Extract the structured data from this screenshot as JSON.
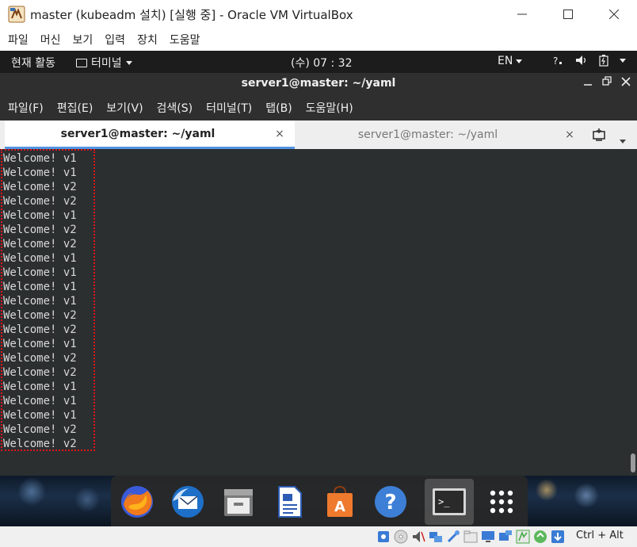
{
  "window": {
    "title": "master (kubeadm 설치) [실행 중] - Oracle VM VirtualBox"
  },
  "vbox_menu": [
    "파일",
    "머신",
    "보기",
    "입력",
    "장치",
    "도움말"
  ],
  "gnome_bar": {
    "activities": "현재 활동",
    "app_menu": "터미널",
    "clock": "(수) 07 : 32",
    "lang": "EN"
  },
  "terminal": {
    "title": "server1@master: ~/yaml",
    "menu": [
      "파일(F)",
      "편집(E)",
      "보기(V)",
      "검색(S)",
      "터미널(T)",
      "탭(B)",
      "도움말(H)"
    ],
    "tabs": [
      {
        "label": "server1@master: ~/yaml",
        "active": true
      },
      {
        "label": "server1@master: ~/yaml",
        "active": false
      }
    ],
    "close_glyph": "×",
    "output": [
      "Welcome! v1",
      "Welcome! v1",
      "Welcome! v2",
      "Welcome! v2",
      "Welcome! v1",
      "Welcome! v2",
      "Welcome! v2",
      "Welcome! v1",
      "Welcome! v1",
      "Welcome! v1",
      "Welcome! v1",
      "Welcome! v2",
      "Welcome! v2",
      "Welcome! v1",
      "Welcome! v2",
      "Welcome! v2",
      "Welcome! v1",
      "Welcome! v1",
      "Welcome! v1",
      "Welcome! v2",
      "Welcome! v2"
    ]
  },
  "dock": {
    "items": [
      {
        "name": "firefox-icon"
      },
      {
        "name": "thunderbird-icon"
      },
      {
        "name": "files-icon"
      },
      {
        "name": "libreoffice-writer-icon"
      },
      {
        "name": "software-center-icon"
      },
      {
        "name": "help-icon",
        "glyph": "?"
      },
      {
        "name": "terminal-icon",
        "glyph": ">_",
        "active": true
      },
      {
        "name": "show-applications-icon"
      }
    ]
  },
  "vbox_status": {
    "host_key": "Ctrl + Alt"
  },
  "colors": {
    "highlight_border": "#e3121c",
    "tab_accent": "#5294e2",
    "terminal_bg": "#2b2f30"
  }
}
